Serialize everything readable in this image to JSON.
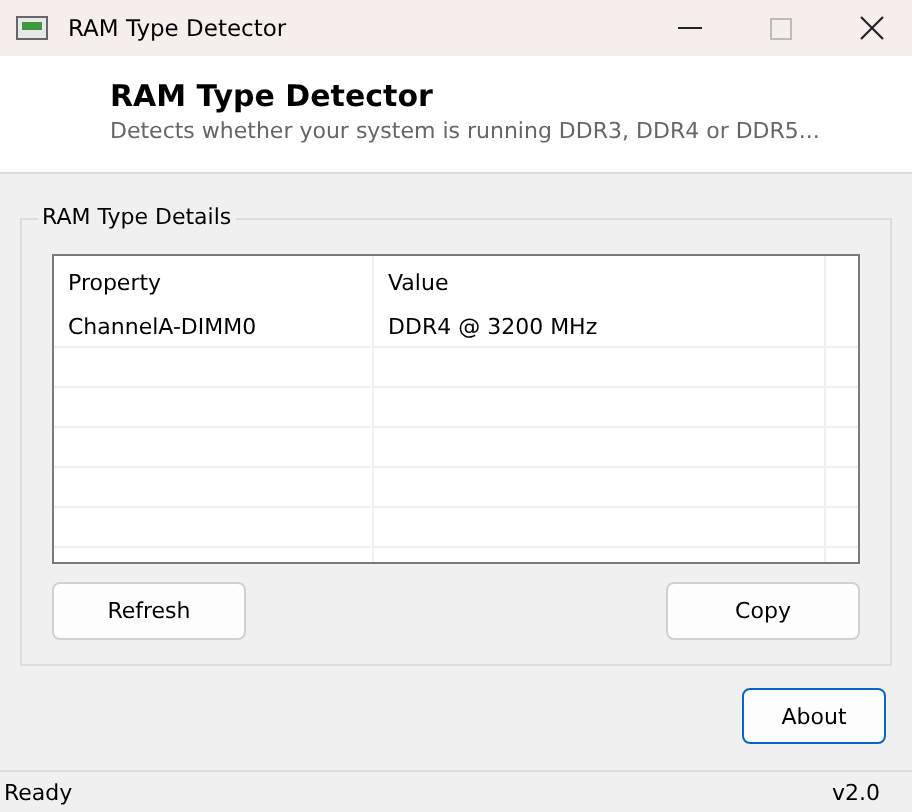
{
  "window": {
    "title": "RAM Type Detector"
  },
  "header": {
    "title": "RAM Type Detector",
    "subtitle": "Detects whether your system is running DDR3, DDR4 or DDR5..."
  },
  "group": {
    "title": "RAM Type Details",
    "table": {
      "columns": [
        "Property",
        "Value"
      ],
      "rows": [
        {
          "property": "ChannelA-DIMM0",
          "value": "DDR4 @ 3200 MHz"
        }
      ]
    },
    "buttons": [
      {
        "label": "Refresh"
      },
      {
        "label": "Copy"
      }
    ]
  },
  "about_button": {
    "label": "About",
    "default": true
  },
  "status_bar": {
    "text": "Ready",
    "version": "v2.0"
  }
}
